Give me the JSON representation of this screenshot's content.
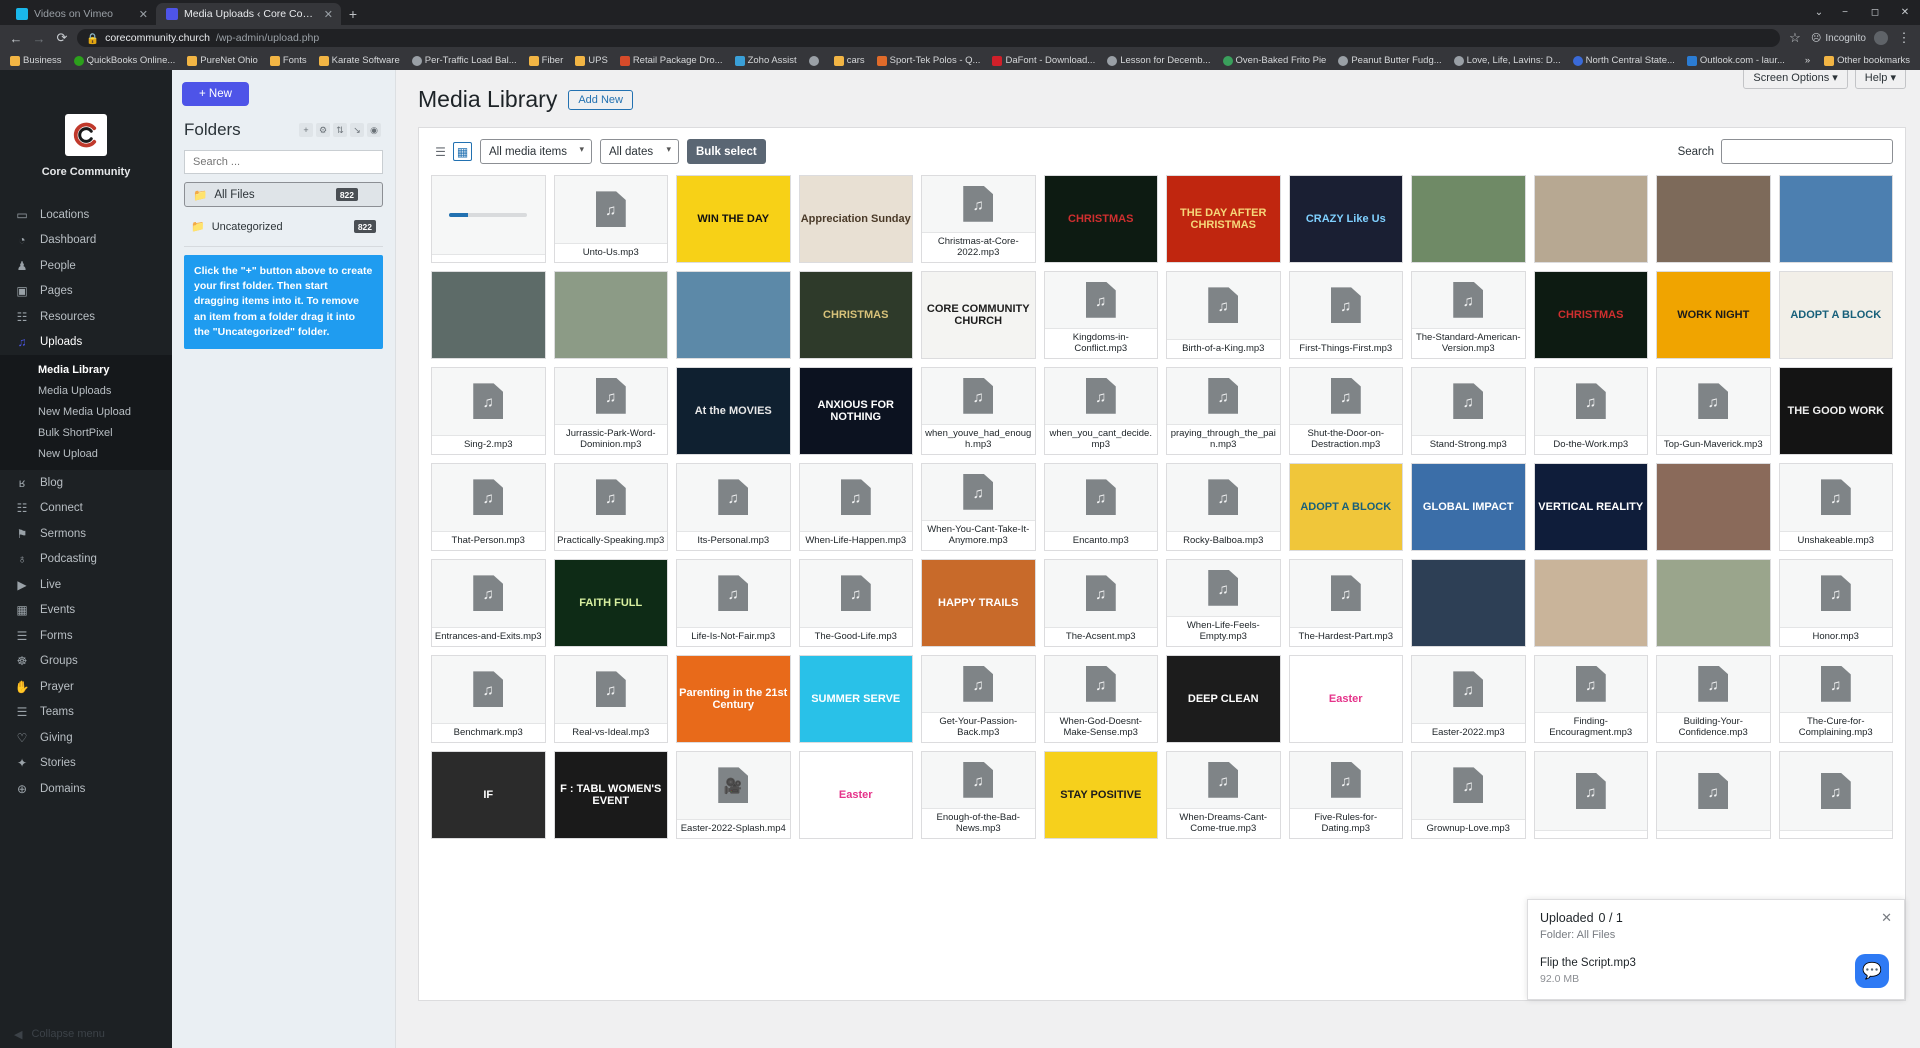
{
  "browser": {
    "tabs": [
      {
        "title": "Videos on Vimeo",
        "favicon_color": "#1ab7ea",
        "favicon_letter": "v",
        "active": false
      },
      {
        "title": "Media Uploads ‹ Core Communit",
        "favicon_color": "#4e54e8",
        "favicon_letter": "⚙",
        "active": true
      }
    ],
    "new_tab_label": "+",
    "nav": {
      "back": "←",
      "forward": "→",
      "reload": "⟳"
    },
    "url_host": "corecommunity.church",
    "url_path": "/wp-admin/upload.php",
    "lock_icon": "lock-icon",
    "star_icon": "☆",
    "incognito_label": "Incognito",
    "window_controls": [
      "−",
      "☐",
      "✕"
    ],
    "bookmarks": [
      {
        "label": "Business",
        "color": "#f2b544"
      },
      {
        "label": "QuickBooks Online...",
        "color": "#2ca01c"
      },
      {
        "label": "PureNet Ohio",
        "color": "#f2b544"
      },
      {
        "label": "Fonts",
        "color": "#f2b544"
      },
      {
        "label": "Karate Software",
        "color": "#f2b544"
      },
      {
        "label": "Per-Traffic Load Bal...",
        "color": "#9aa0a6"
      },
      {
        "label": "Fiber",
        "color": "#f2b544"
      },
      {
        "label": "UPS",
        "color": "#f2b544"
      },
      {
        "label": "Retail Package Dro...",
        "color": "#d64b2a"
      },
      {
        "label": "Zoho Assist",
        "color": "#3aa0d8"
      },
      {
        "label": "",
        "color": "#9aa0a6"
      },
      {
        "label": "cars",
        "color": "#f2b544"
      },
      {
        "label": "Sport-Tek Polos - Q...",
        "color": "#e06b2a"
      },
      {
        "label": "DaFont - Download...",
        "color": "#d0202a"
      },
      {
        "label": "Lesson for Decemb...",
        "color": "#9aa0a6"
      },
      {
        "label": "Oven-Baked Frito Pie",
        "color": "#3aa05c"
      },
      {
        "label": "Peanut Butter Fudg...",
        "color": "#9aa0a6"
      },
      {
        "label": "Love, Life, Lavins: D...",
        "color": "#9aa0a6"
      },
      {
        "label": "North Central State...",
        "color": "#3a6ad8"
      },
      {
        "label": "Outlook.com - laur...",
        "color": "#2b7cd3"
      }
    ],
    "bookmarks_overflow": "»",
    "other_bookmarks": "Other bookmarks"
  },
  "sidebar": {
    "brand_name": "Core Community",
    "items": [
      {
        "label": "Locations",
        "icon": "▭",
        "active": false
      },
      {
        "label": "Dashboard",
        "icon": "◔",
        "active": false
      },
      {
        "label": "People",
        "icon": "♟",
        "active": false
      },
      {
        "label": "Pages",
        "icon": "▣",
        "active": false
      },
      {
        "label": "Resources",
        "icon": "☷",
        "active": false
      },
      {
        "label": "Uploads",
        "icon": "♫",
        "active": true
      }
    ],
    "submenu": [
      {
        "label": "Media Library",
        "current": true
      },
      {
        "label": "Media Uploads",
        "current": false
      },
      {
        "label": "New Media Upload",
        "current": false
      },
      {
        "label": "Bulk ShortPixel",
        "current": false
      },
      {
        "label": "New Upload",
        "current": false
      }
    ],
    "items_bottom": [
      {
        "label": "Blog",
        "icon": "ʁ"
      },
      {
        "label": "Connect",
        "icon": "☷"
      },
      {
        "label": "Sermons",
        "icon": "⚑"
      },
      {
        "label": "Podcasting",
        "icon": "♁"
      },
      {
        "label": "Live",
        "icon": "▶"
      },
      {
        "label": "Events",
        "icon": "▦"
      },
      {
        "label": "Forms",
        "icon": "☰"
      },
      {
        "label": "Groups",
        "icon": "☸"
      },
      {
        "label": "Prayer",
        "icon": "✋"
      },
      {
        "label": "Teams",
        "icon": "☰"
      },
      {
        "label": "Giving",
        "icon": "♡"
      },
      {
        "label": "Stories",
        "icon": "✦"
      },
      {
        "label": "Domains",
        "icon": "⊕"
      }
    ],
    "collapse_label": "Collapse menu"
  },
  "folders": {
    "new_button": "+ New",
    "title": "Folders",
    "header_icons": [
      "plus-icon",
      "gear-icon",
      "sort-icon",
      "collapse-icon",
      "eye-icon"
    ],
    "search_placeholder": "Search ...",
    "list": [
      {
        "label": "All Files",
        "count": "822",
        "selected": true
      },
      {
        "label": "Uncategorized",
        "count": "822",
        "selected": false
      }
    ],
    "tip": "Click the \"+\" button above to create your first folder. Then start dragging items into it. To remove an item from a folder drag it into the \"Uncategorized\" folder."
  },
  "topbar": {
    "screen_options": "Screen Options",
    "help": "Help",
    "icons": [
      "bolt-icon",
      "question-icon",
      "account-icon"
    ]
  },
  "main": {
    "page_title": "Media Library",
    "add_new": "Add New",
    "view_list_icon": "list-view-icon",
    "view_grid_icon": "grid-view-icon",
    "filter_media": "All media items",
    "filter_dates": "All dates",
    "bulk_select": "Bulk select",
    "search_label": "Search",
    "search_value": ""
  },
  "upload_panel": {
    "title": "Uploaded",
    "progress": "0 / 1",
    "folder_line": "Folder: All Files",
    "file_name": "Flip the Script.mp3",
    "file_size": "92.0 MB",
    "close_icon": "close-icon"
  },
  "chat": {
    "icon": "chat-bubble-icon"
  },
  "grid": {
    "items": [
      {
        "name": "",
        "kind": "progress"
      },
      {
        "name": "Unto-Us.mp3",
        "kind": "audio"
      },
      {
        "name": "",
        "kind": "image",
        "bg": "#f7d117",
        "color": "#111",
        "text": "WIN\nTHE\nDAY"
      },
      {
        "name": "",
        "kind": "image",
        "bg": "#e8e0d3",
        "color": "#4a3a28",
        "text": "Appreciation Sunday"
      },
      {
        "name": "Christmas-at-Core-2022.mp3",
        "kind": "audio"
      },
      {
        "name": "",
        "kind": "image",
        "bg": "#0d1b12",
        "color": "#cf2f2f",
        "text": "CHRISTMAS"
      },
      {
        "name": "",
        "kind": "image",
        "bg": "#c0260f",
        "color": "#f5d77a",
        "text": "THE DAY AFTER CHRISTMAS"
      },
      {
        "name": "",
        "kind": "image",
        "bg": "#1a1f33",
        "color": "#7fd0ff",
        "text": "CRAZY Like Us"
      },
      {
        "name": "",
        "kind": "image",
        "bg": "#6f8a66",
        "color": "#fff",
        "text": ""
      },
      {
        "name": "",
        "kind": "image",
        "bg": "#b7a892",
        "color": "#fff",
        "text": ""
      },
      {
        "name": "",
        "kind": "image",
        "bg": "#7d6a5a",
        "color": "#fff",
        "text": ""
      },
      {
        "name": "",
        "kind": "image",
        "bg": "#4c7fb0",
        "color": "#fff",
        "text": ""
      },
      {
        "name": "",
        "kind": "image",
        "bg": "#5d6b68",
        "color": "#fff",
        "text": ""
      },
      {
        "name": "",
        "kind": "image",
        "bg": "#8c9b86",
        "color": "#fff",
        "text": ""
      },
      {
        "name": "",
        "kind": "image",
        "bg": "#5c89a8",
        "color": "#fff",
        "text": ""
      },
      {
        "name": "",
        "kind": "image",
        "bg": "#2e3a2a",
        "color": "#d8c27a",
        "text": "CHRISTMAS"
      },
      {
        "name": "",
        "kind": "image",
        "bg": "#f4f4f2",
        "color": "#1d1d1d",
        "text": "CORE COMMUNITY CHURCH"
      },
      {
        "name": "Kingdoms-in-Conflict.mp3",
        "kind": "audio"
      },
      {
        "name": "Birth-of-a-King.mp3",
        "kind": "audio"
      },
      {
        "name": "First-Things-First.mp3",
        "kind": "audio"
      },
      {
        "name": "The-Standard-American-Version.mp3",
        "kind": "audio"
      },
      {
        "name": "",
        "kind": "image",
        "bg": "#0d1b12",
        "color": "#cf2f2f",
        "text": "CHRISTMAS"
      },
      {
        "name": "",
        "kind": "image",
        "bg": "#f0a400",
        "color": "#1b1b1b",
        "text": "WORK NIGHT"
      },
      {
        "name": "",
        "kind": "image",
        "bg": "#f2efe8",
        "color": "#18607a",
        "text": "ADOPT A BLOCK"
      },
      {
        "name": "Sing-2.mp3",
        "kind": "audio"
      },
      {
        "name": "Jurrassic-Park-Word-Dominion.mp3",
        "kind": "audio"
      },
      {
        "name": "",
        "kind": "image",
        "bg": "#0f2030",
        "color": "#e8e8e8",
        "text": "At the MOVIES"
      },
      {
        "name": "",
        "kind": "image",
        "bg": "#0c1220",
        "color": "#ffffff",
        "text": "ANXIOUS FOR NOTHING"
      },
      {
        "name": "when_youve_had_enough.mp3",
        "kind": "audio"
      },
      {
        "name": "when_you_cant_decide.mp3",
        "kind": "audio"
      },
      {
        "name": "praying_through_the_pain.mp3",
        "kind": "audio"
      },
      {
        "name": "Shut-the-Door-on-Destraction.mp3",
        "kind": "audio"
      },
      {
        "name": "Stand-Strong.mp3",
        "kind": "audio"
      },
      {
        "name": "Do-the-Work.mp3",
        "kind": "audio"
      },
      {
        "name": "Top-Gun-Maverick.mp3",
        "kind": "audio"
      },
      {
        "name": "",
        "kind": "image",
        "bg": "#141414",
        "color": "#f0f0f0",
        "text": "THE GOOD WORK"
      },
      {
        "name": "That-Person.mp3",
        "kind": "audio"
      },
      {
        "name": "Practically-Speaking.mp3",
        "kind": "audio"
      },
      {
        "name": "Its-Personal.mp3",
        "kind": "audio"
      },
      {
        "name": "When-Life-Happen.mp3",
        "kind": "audio"
      },
      {
        "name": "When-You-Cant-Take-It-Anymore.mp3",
        "kind": "audio"
      },
      {
        "name": "Encanto.mp3",
        "kind": "audio"
      },
      {
        "name": "Rocky-Balboa.mp3",
        "kind": "audio"
      },
      {
        "name": "",
        "kind": "image",
        "bg": "#f0c63a",
        "color": "#18607a",
        "text": "ADOPT A BLOCK"
      },
      {
        "name": "",
        "kind": "image",
        "bg": "#3b6ea8",
        "color": "#fff",
        "text": "GLOBAL IMPACT"
      },
      {
        "name": "",
        "kind": "image",
        "bg": "#0f1d3a",
        "color": "#fff",
        "text": "VERTICAL REALITY"
      },
      {
        "name": "",
        "kind": "image",
        "bg": "#8a6a5a",
        "color": "#fff",
        "text": ""
      },
      {
        "name": "Unshakeable.mp3",
        "kind": "audio"
      },
      {
        "name": "Entrances-and-Exits.mp3",
        "kind": "audio"
      },
      {
        "name": "",
        "kind": "image",
        "bg": "#0e2b16",
        "color": "#d8f0a0",
        "text": "FAITH FULL"
      },
      {
        "name": "Life-Is-Not-Fair.mp3",
        "kind": "audio"
      },
      {
        "name": "The-Good-Life.mp3",
        "kind": "audio"
      },
      {
        "name": "",
        "kind": "image",
        "bg": "#c86a2a",
        "color": "#fff",
        "text": "HAPPY TRAILS"
      },
      {
        "name": "The-Acsent.mp3",
        "kind": "audio"
      },
      {
        "name": "When-Life-Feels-Empty.mp3",
        "kind": "audio"
      },
      {
        "name": "The-Hardest-Part.mp3",
        "kind": "audio"
      },
      {
        "name": "",
        "kind": "image",
        "bg": "#2d3f55",
        "color": "#fff",
        "text": ""
      },
      {
        "name": "",
        "kind": "image",
        "bg": "#c9b49a",
        "color": "#fff",
        "text": ""
      },
      {
        "name": "",
        "kind": "image",
        "bg": "#9aa58c",
        "color": "#fff",
        "text": ""
      },
      {
        "name": "Honor.mp3",
        "kind": "audio"
      },
      {
        "name": "Benchmark.mp3",
        "kind": "audio"
      },
      {
        "name": "Real-vs-Ideal.mp3",
        "kind": "audio"
      },
      {
        "name": "",
        "kind": "image",
        "bg": "#e86a1a",
        "color": "#fff",
        "text": "Parenting in the 21st Century"
      },
      {
        "name": "",
        "kind": "image",
        "bg": "#29c1e8",
        "color": "#fff",
        "text": "SUMMER SERVE"
      },
      {
        "name": "Get-Your-Passion-Back.mp3",
        "kind": "audio"
      },
      {
        "name": "When-God-Doesnt-Make-Sense.mp3",
        "kind": "audio"
      },
      {
        "name": "",
        "kind": "image",
        "bg": "#1c1c1c",
        "color": "#fff",
        "text": "DEEP CLEAN"
      },
      {
        "name": "",
        "kind": "image",
        "bg": "#ffffff",
        "color": "#e5338a",
        "text": "Easter"
      },
      {
        "name": "Easter-2022.mp3",
        "kind": "audio"
      },
      {
        "name": "Finding-Encouragment.mp3",
        "kind": "audio"
      },
      {
        "name": "Building-Your-Confidence.mp3",
        "kind": "audio"
      },
      {
        "name": "The-Cure-for-Complaining.mp3",
        "kind": "audio"
      },
      {
        "name": "",
        "kind": "image",
        "bg": "#2b2b2b",
        "color": "#fff",
        "text": "IF"
      },
      {
        "name": "",
        "kind": "image",
        "bg": "#1a1a1a",
        "color": "#fff",
        "text": "F : TABL WOMEN'S EVENT"
      },
      {
        "name": "Easter-2022-Splash.mp4",
        "kind": "video"
      },
      {
        "name": "",
        "kind": "image",
        "bg": "#ffffff",
        "color": "#e5338a",
        "text": "Easter"
      },
      {
        "name": "Enough-of-the-Bad-News.mp3",
        "kind": "audio"
      },
      {
        "name": "",
        "kind": "image",
        "bg": "#f6d01c",
        "color": "#1b1b1b",
        "text": "STAY POSITIVE"
      },
      {
        "name": "When-Dreams-Cant-Come-true.mp3",
        "kind": "audio"
      },
      {
        "name": "Five-Rules-for-Dating.mp3",
        "kind": "audio"
      },
      {
        "name": "Grownup-Love.mp3",
        "kind": "audio"
      },
      {
        "name": "",
        "kind": "audio"
      },
      {
        "name": "",
        "kind": "audio"
      },
      {
        "name": "",
        "kind": "audio"
      }
    ]
  }
}
